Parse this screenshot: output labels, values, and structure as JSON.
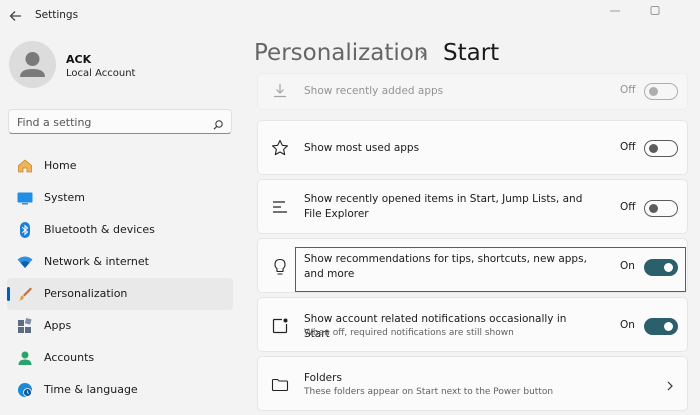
{
  "window": {
    "title": "Settings"
  },
  "user": {
    "name": "ACK",
    "account_type": "Local Account"
  },
  "search": {
    "placeholder": "Find a setting"
  },
  "sidebar": {
    "items": [
      {
        "label": "Home"
      },
      {
        "label": "System"
      },
      {
        "label": "Bluetooth & devices"
      },
      {
        "label": "Network & internet"
      },
      {
        "label": "Personalization",
        "active": true
      },
      {
        "label": "Apps"
      },
      {
        "label": "Accounts"
      },
      {
        "label": "Time & language"
      }
    ]
  },
  "breadcrumb": {
    "parent": "Personalization",
    "separator": "›",
    "current": "Start"
  },
  "settings": [
    {
      "title": "Show recently added apps",
      "state": "Off",
      "icon": "download-icon"
    },
    {
      "title": "Show most used apps",
      "state": "Off",
      "icon": "star-icon"
    },
    {
      "title": "Show recently opened items in Start, Jump Lists, and File Explorer",
      "state": "Off",
      "icon": "list-icon"
    },
    {
      "title": "Show recommendations for tips, shortcuts, new apps, and more",
      "state": "On",
      "icon": "lightbulb-icon"
    },
    {
      "title": "Show account related notifications occasionally in Start",
      "description": "When off, required notifications are still shown",
      "state": "On",
      "icon": "notification-icon"
    },
    {
      "title": "Folders",
      "description": "These folders appear on Start next to the Power button",
      "icon": "folder-icon"
    }
  ],
  "colors": {
    "accent": "#2c5f6c",
    "highlight": "#d9262b",
    "nav_indicator": "#005fb8"
  }
}
